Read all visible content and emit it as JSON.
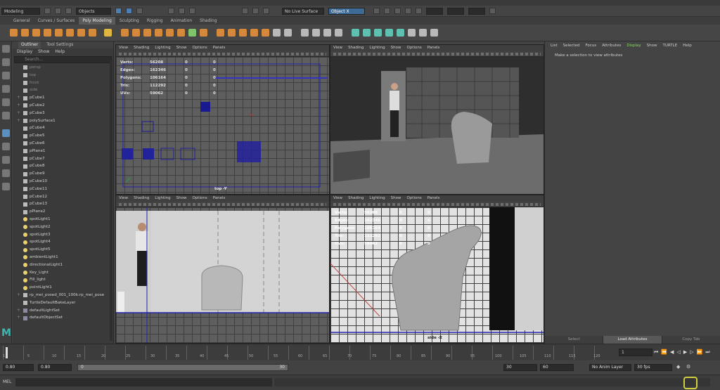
{
  "status_line": {
    "menuset": "Modeling",
    "selection_mode": "Objects",
    "live_surface": "No Live Surface",
    "xyz_label": "Object X"
  },
  "shelf_tabs": [
    "General",
    "Curves / Surfaces",
    "Poly Modeling",
    "Sculpting",
    "Rigging",
    "Animation",
    "Shading"
  ],
  "shelf_active": "Poly Modeling",
  "outliner": {
    "tabs": [
      "Outliner",
      "Tool Settings"
    ],
    "menu": [
      "Display",
      "Show",
      "Help"
    ],
    "search_placeholder": "Search...",
    "items": [
      {
        "name": "persp",
        "dim": true,
        "type": "cam"
      },
      {
        "name": "top",
        "dim": true,
        "type": "cam"
      },
      {
        "name": "front",
        "dim": true,
        "type": "cam"
      },
      {
        "name": "side",
        "dim": true,
        "type": "cam"
      },
      {
        "name": "pCube1",
        "type": "mesh",
        "exp": true
      },
      {
        "name": "pCube2",
        "type": "mesh",
        "exp": true
      },
      {
        "name": "pCube3",
        "type": "mesh",
        "exp": true
      },
      {
        "name": "polySurface1",
        "type": "mesh",
        "exp": true
      },
      {
        "name": "pCube4",
        "type": "mesh"
      },
      {
        "name": "pCube5",
        "type": "mesh"
      },
      {
        "name": "pCube6",
        "type": "mesh"
      },
      {
        "name": "pPlane1",
        "type": "mesh"
      },
      {
        "name": "pCube7",
        "type": "mesh"
      },
      {
        "name": "pCube8",
        "type": "mesh"
      },
      {
        "name": "pCube9",
        "type": "mesh"
      },
      {
        "name": "pCube10",
        "type": "mesh"
      },
      {
        "name": "pCube11",
        "type": "mesh"
      },
      {
        "name": "pCube12",
        "type": "mesh"
      },
      {
        "name": "pCube13",
        "type": "mesh"
      },
      {
        "name": "pPlane2",
        "type": "mesh"
      },
      {
        "name": "spotLight1",
        "type": "light"
      },
      {
        "name": "spotLight2",
        "type": "light"
      },
      {
        "name": "spotLight3",
        "type": "light"
      },
      {
        "name": "spotLight4",
        "type": "light"
      },
      {
        "name": "spotLight5",
        "type": "light"
      },
      {
        "name": "ambientLight1",
        "type": "light"
      },
      {
        "name": "directionalLight1",
        "type": "light"
      },
      {
        "name": "Key_Light",
        "type": "light"
      },
      {
        "name": "Fill_light",
        "type": "light"
      },
      {
        "name": "pointLight1",
        "type": "light"
      },
      {
        "name": "rp_mei_posed_001_100k:rp_mei_pose",
        "type": "mesh",
        "exp": true
      },
      {
        "name": "TurtleDefaultBakeLayer",
        "type": "mesh"
      },
      {
        "name": "defaultLightSet",
        "type": "set",
        "exp": true
      },
      {
        "name": "defaultObjectSet",
        "type": "set",
        "exp": true
      }
    ]
  },
  "viewport_menu": [
    "View",
    "Shading",
    "Lighting",
    "Show",
    "Options",
    "Panels"
  ],
  "hud": {
    "labels": [
      "Verts:",
      "Edges:",
      "Polygons:",
      "Tris:",
      "UVs:"
    ],
    "values": [
      "56208",
      "162346",
      "106164",
      "112292",
      "59062"
    ],
    "zeros": [
      "0",
      "0",
      "0",
      "0",
      "0"
    ],
    "zeros2": [
      "0",
      "0",
      "0",
      "0",
      "0"
    ]
  },
  "viewports": {
    "top_label": "top -Y",
    "side_label": "side -X"
  },
  "attribute_editor": {
    "menu": [
      "List",
      "Selected",
      "Focus",
      "Attributes",
      "Display",
      "Show",
      "TURTLE",
      "Help"
    ],
    "highlight": "Display",
    "message": "Make a selection to view attributes",
    "buttons": [
      "Select",
      "Load Attributes",
      "Copy Tab"
    ]
  },
  "time_slider": {
    "ticks": [
      "1",
      "5",
      "10",
      "15",
      "20",
      "25",
      "30",
      "35",
      "40",
      "45",
      "50",
      "55",
      "60",
      "65",
      "70",
      "75",
      "80",
      "85",
      "90",
      "95",
      "100",
      "105",
      "110",
      "115",
      "120"
    ],
    "current_frame": "1"
  },
  "range_slider": {
    "start": "0.80",
    "start_inner": "0.80",
    "range_start": "0",
    "range_end": "30",
    "end_inner": "30",
    "end": "60",
    "anim_layer": "No Anim Layer",
    "fps": "30 fps"
  },
  "command_line": {
    "label": "MEL"
  }
}
